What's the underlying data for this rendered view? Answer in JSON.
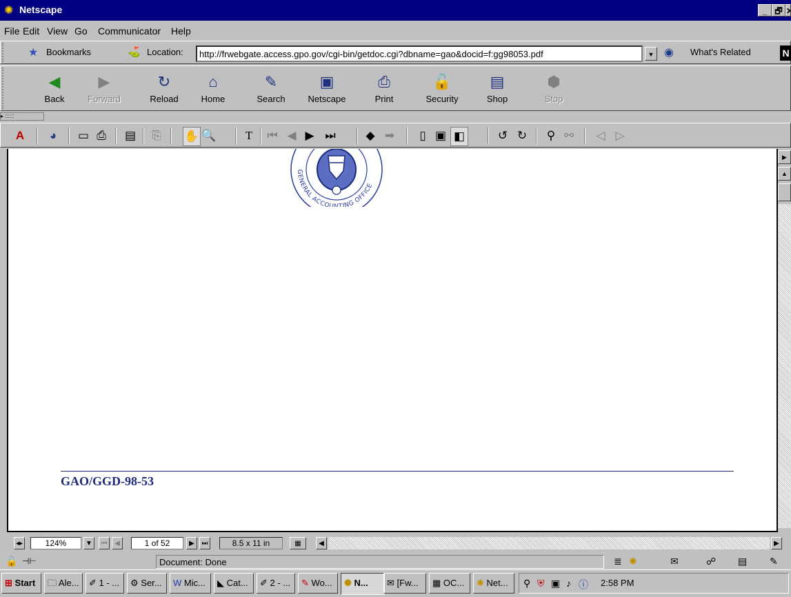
{
  "window": {
    "title": "Netscape",
    "minimize_label": "_",
    "restore_label": "🗗",
    "close_label": "✕"
  },
  "menu": [
    "File",
    "Edit",
    "View",
    "Go",
    "Communicator",
    "Help"
  ],
  "location": {
    "bookmarks_label": "Bookmarks",
    "location_label": "Location:",
    "url": "http://frwebgate.access.gpo.gov/cgi-bin/getdoc.cgi?dbname=gao&docid=f:gg98053.pdf",
    "related_label": "What's Related"
  },
  "nav": [
    {
      "label": "Back",
      "icon": "◀"
    },
    {
      "label": "Forward",
      "icon": "▶"
    },
    {
      "label": "Reload",
      "icon": "↻"
    },
    {
      "label": "Home",
      "icon": "⌂"
    },
    {
      "label": "Search",
      "icon": "✎"
    },
    {
      "label": "Netscape",
      "icon": "▣"
    },
    {
      "label": "Print",
      "icon": "⎙"
    },
    {
      "label": "Security",
      "icon": "🔓"
    },
    {
      "label": "Shop",
      "icon": "▤"
    },
    {
      "label": "Stop",
      "icon": "⬢"
    }
  ],
  "document": {
    "seal_text": "GENERAL ACCOUNTING OFFICE",
    "report_id": "GAO/GGD-98-53"
  },
  "pdf_status": {
    "zoom": "124%",
    "page": "1 of 52",
    "page_size": "8.5 x 11 in"
  },
  "status_text": "Document: Done",
  "taskbar": {
    "start_label": "Start",
    "tasks": [
      "Ale...",
      "1 - ...",
      "Ser...",
      "Mic...",
      "Cat...",
      "2 - ...",
      "Wo...",
      "N...",
      "[Fw...",
      "OC...",
      "Net..."
    ],
    "clock": "2:58 PM"
  },
  "colors": {
    "titlebar": "#000080",
    "chrome": "#c0c0c0",
    "doc_text": "#1f2b7a"
  }
}
